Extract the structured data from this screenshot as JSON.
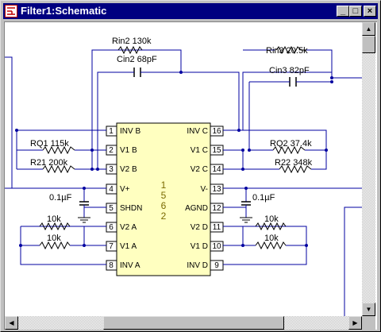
{
  "window": {
    "title": "Filter1:Schematic",
    "controls": {
      "minimize": "_",
      "maximize": "□",
      "close": "×"
    }
  },
  "colors": {
    "wire": "#0000a0",
    "chip_fill": "#ffffc0",
    "pin_num": "#000000",
    "titlebar": "#000080"
  },
  "chip": {
    "part": "1562",
    "digits": [
      "1",
      "5",
      "6",
      "2"
    ]
  },
  "pins": {
    "left": [
      {
        "num": "1",
        "name": "INV B"
      },
      {
        "num": "2",
        "name": "V1 B"
      },
      {
        "num": "3",
        "name": "V2 B"
      },
      {
        "num": "4",
        "name": "V+"
      },
      {
        "num": "5",
        "name": "SHDN"
      },
      {
        "num": "6",
        "name": "V2 A"
      },
      {
        "num": "7",
        "name": "V1 A"
      },
      {
        "num": "8",
        "name": "INV A"
      }
    ],
    "right": [
      {
        "num": "16",
        "name": "INV C"
      },
      {
        "num": "15",
        "name": "V1 C"
      },
      {
        "num": "14",
        "name": "V2 C"
      },
      {
        "num": "13",
        "name": "V-"
      },
      {
        "num": "12",
        "name": "AGND"
      },
      {
        "num": "11",
        "name": "V2 D"
      },
      {
        "num": "10",
        "name": "V1 D"
      },
      {
        "num": "9",
        "name": "INV D"
      }
    ]
  },
  "components": {
    "rin2": "Rin2 130k",
    "cin2": "Cin2 68pF",
    "rin3": "Rin3 20.5k",
    "cin3": "Cin3 82pF",
    "rq1": "RQ1 115k",
    "r21": "R21 200k",
    "rq2": "RQ2 37.4k",
    "r22": "R22 348k",
    "cap_vplus": "0.1µF",
    "cap_vminus": "0.1µF",
    "r_a1": "10k",
    "r_a2": "10k",
    "r_d1": "10k",
    "r_d2": "10k"
  },
  "scroll": {
    "up": "▲",
    "down": "▼",
    "left": "◀",
    "right": "▶"
  }
}
